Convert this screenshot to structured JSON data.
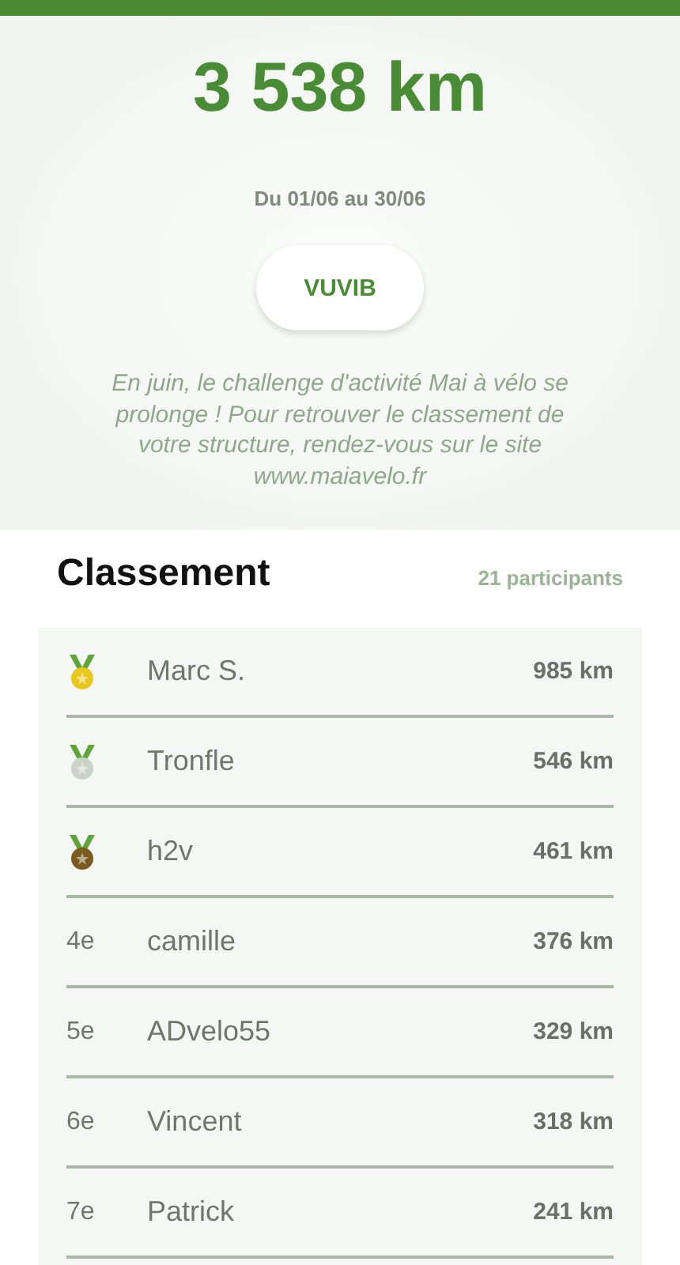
{
  "total": "3 538 km",
  "period": "Du 01/06 au 30/06",
  "team_button": "VUVIB",
  "message": "En juin, le challenge d'activité Mai à vélo se prolonge ! Pour retrouver le classement de votre structure, rendez-vous sur le site www.maiavelo.fr",
  "ranking": {
    "title": "Classement",
    "count": "21 participants",
    "rows": [
      {
        "kind": "medal",
        "color": "#e8c81e",
        "name": "Marc S.",
        "distance": "985 km"
      },
      {
        "kind": "medal",
        "color": "#c9d3c7",
        "name": "Tronfle",
        "distance": "546 km"
      },
      {
        "kind": "medal",
        "color": "#7a5a1e",
        "name": "h2v",
        "distance": "461 km"
      },
      {
        "kind": "rank",
        "rank": "4e",
        "name": "camille",
        "distance": "376 km"
      },
      {
        "kind": "rank",
        "rank": "5e",
        "name": "ADvelo55",
        "distance": "329 km"
      },
      {
        "kind": "rank",
        "rank": "6e",
        "name": "Vincent",
        "distance": "318 km"
      },
      {
        "kind": "rank",
        "rank": "7e",
        "name": "Patrick",
        "distance": "241 km"
      }
    ]
  }
}
